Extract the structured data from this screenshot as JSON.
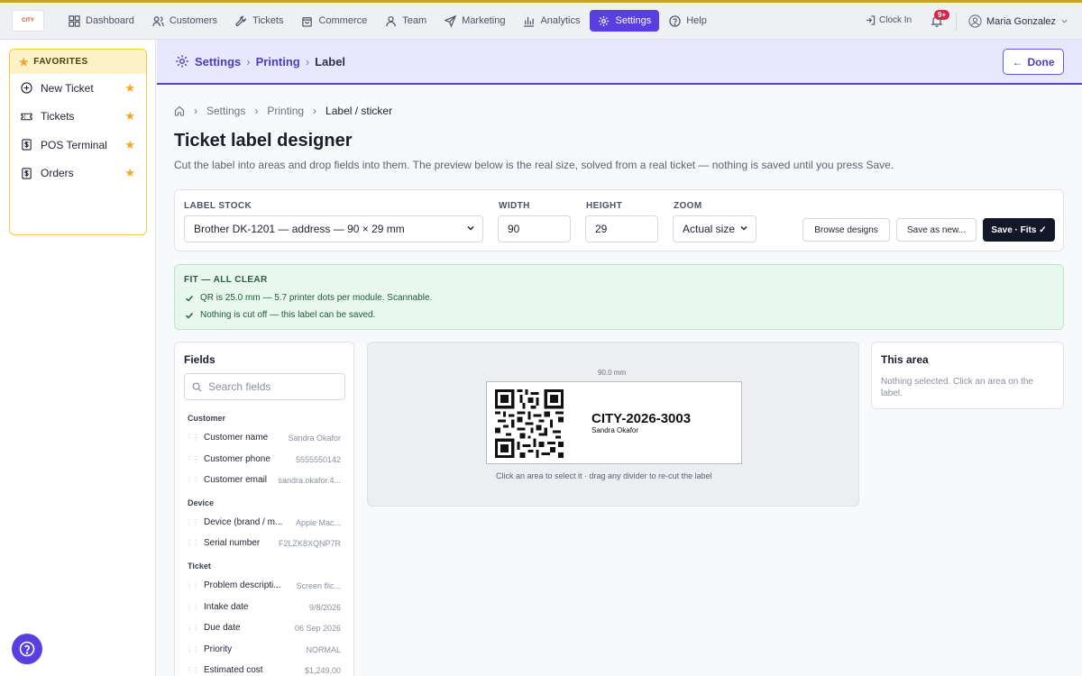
{
  "app": {
    "logo_text": "CITY"
  },
  "nav": {
    "items": [
      {
        "label": "Dashboard",
        "icon": "grid-icon"
      },
      {
        "label": "Customers",
        "icon": "users-icon"
      },
      {
        "label": "Tickets",
        "icon": "wrench-icon"
      },
      {
        "label": "Commerce",
        "icon": "bag-icon"
      },
      {
        "label": "Team",
        "icon": "team-icon"
      },
      {
        "label": "Marketing",
        "icon": "send-icon"
      },
      {
        "label": "Analytics",
        "icon": "bar-chart-icon"
      },
      {
        "label": "Settings",
        "icon": "gear-icon",
        "active": true
      },
      {
        "label": "Help",
        "icon": "help-icon"
      }
    ],
    "clock_in": "Clock In",
    "notifications_badge": "9+",
    "user_name": "Maria Gonzalez"
  },
  "sidebar": {
    "favorites_title": "FAVORITES",
    "items": [
      {
        "label": "New Ticket",
        "icon": "plus-circle-icon"
      },
      {
        "label": "Tickets",
        "icon": "ticket-icon"
      },
      {
        "label": "POS Terminal",
        "icon": "receipt-icon"
      },
      {
        "label": "Orders",
        "icon": "receipt-icon"
      }
    ]
  },
  "header": {
    "crumbs": [
      "Settings",
      "Printing",
      "Label"
    ],
    "done_label": "Done"
  },
  "breadcrumb": {
    "items": [
      "Settings",
      "Printing"
    ],
    "current": "Label / sticker"
  },
  "page": {
    "title": "Ticket label designer",
    "subtitle": "Cut the label into areas and drop fields into them. The preview below is the real size, solved from a real ticket — nothing is saved until you press Save."
  },
  "toolbar": {
    "stock_label": "LABEL STOCK",
    "stock_value": "Brother DK-1201 — address — 90 × 29 mm",
    "width_label": "WIDTH",
    "width_value": "90",
    "height_label": "HEIGHT",
    "height_value": "29",
    "zoom_label": "ZOOM",
    "zoom_value": "Actual size",
    "browse_label": "Browse designs",
    "save_as_label": "Save as new...",
    "save_label": "Save · Fits ✓"
  },
  "fit": {
    "title": "FIT — ALL CLEAR",
    "lines": [
      "QR is 25.0 mm — 5.7 printer dots per module. Scannable.",
      "Nothing is cut off — this label can be saved."
    ]
  },
  "fields": {
    "title": "Fields",
    "search_placeholder": "Search fields",
    "groups": [
      {
        "name": "Customer",
        "rows": [
          {
            "name": "Customer name",
            "value": "Sandra Okafor"
          },
          {
            "name": "Customer phone",
            "value": "5555550142"
          },
          {
            "name": "Customer email",
            "value": "sandra.okafor.4..."
          }
        ]
      },
      {
        "name": "Device",
        "rows": [
          {
            "name": "Device (brand / m...",
            "value": "Apple Mac..."
          },
          {
            "name": "Serial number",
            "value": "F2LZK8XQNP7R"
          }
        ]
      },
      {
        "name": "Ticket",
        "rows": [
          {
            "name": "Problem descripti...",
            "value": "Screen flic..."
          },
          {
            "name": "Intake date",
            "value": "9/8/2026"
          },
          {
            "name": "Due date",
            "value": "06 Sep 2026"
          },
          {
            "name": "Priority",
            "value": "NORMAL"
          },
          {
            "name": "Estimated cost",
            "value": "$1,249.00"
          }
        ]
      }
    ]
  },
  "preview": {
    "dimension": "90.0 mm",
    "ticket_code": "CITY-2026-3003",
    "customer": "Sandra Okafor",
    "hint": "Click an area to select it · drag any divider to re-cut the label"
  },
  "area": {
    "title": "This area",
    "empty_text": "Nothing selected. Click an area on the label."
  },
  "colors": {
    "accent": "#5a3fe0",
    "success_bg": "#e9f8ef",
    "favorites": "#f0c948"
  }
}
